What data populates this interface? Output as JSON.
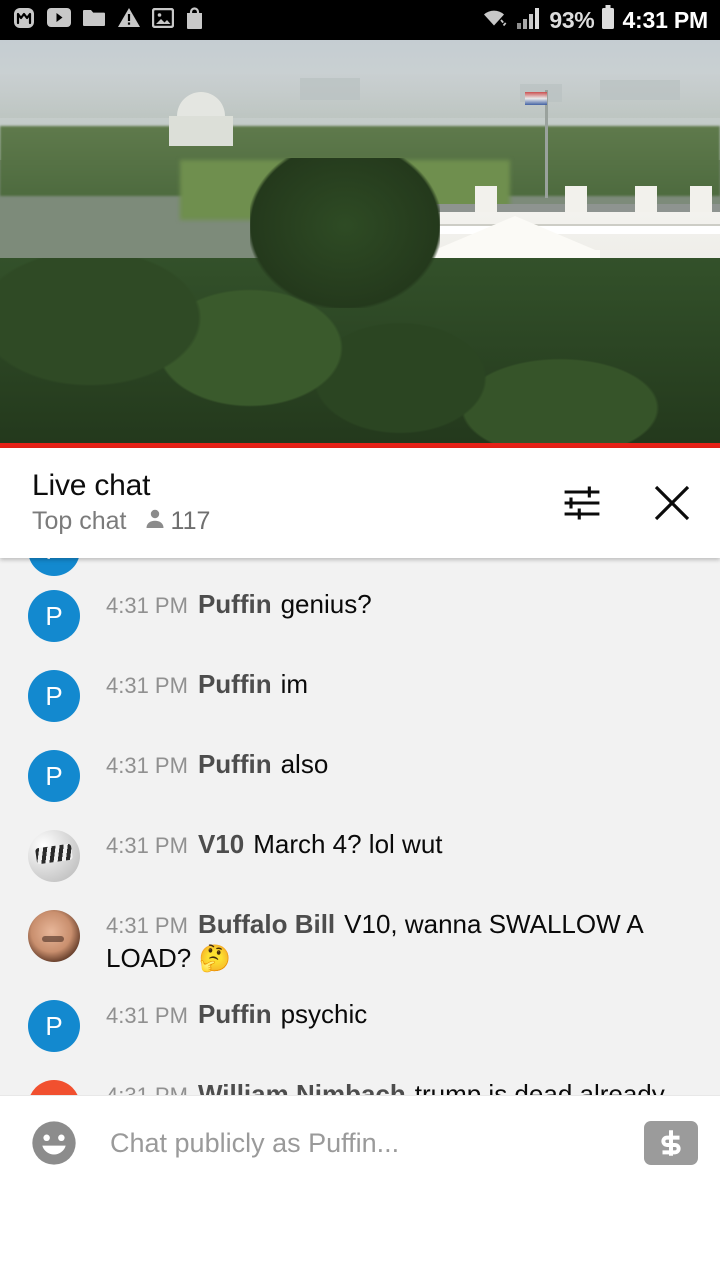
{
  "status_bar": {
    "left_icons": [
      "monzo-m-icon",
      "youtube-play-icon",
      "folder-icon",
      "warning-triangle-icon",
      "image-icon",
      "shopping-bag-icon"
    ],
    "right_icons": [
      "wifi-icon",
      "cellular-signal-icon",
      "battery-icon"
    ],
    "battery_percent": "93%",
    "time": "4:31 PM"
  },
  "video": {
    "description": "White House live stream",
    "progress_color": "#e62117"
  },
  "chat_header": {
    "title": "Live chat",
    "mode": "Top chat",
    "viewer_count": "117",
    "viewer_icon": "person-icon",
    "settings_icon": "tune-sliders-icon",
    "close_icon": "close-x-icon"
  },
  "messages": [
    {
      "avatar_type": "initial",
      "avatar_letter": "P",
      "avatar_color": "#1389cf",
      "timestamp": "",
      "author": "",
      "text": "",
      "partial": true
    },
    {
      "avatar_type": "initial",
      "avatar_letter": "P",
      "avatar_color": "#1389cf",
      "timestamp": "4:31 PM",
      "author": "Puffin",
      "text": "genius?"
    },
    {
      "avatar_type": "initial",
      "avatar_letter": "P",
      "avatar_color": "#1389cf",
      "timestamp": "4:31 PM",
      "author": "Puffin",
      "text": "im"
    },
    {
      "avatar_type": "initial",
      "avatar_letter": "P",
      "avatar_color": "#1389cf",
      "timestamp": "4:31 PM",
      "author": "Puffin",
      "text": "also"
    },
    {
      "avatar_type": "photo-gray",
      "avatar_letter": "",
      "avatar_color": "#cfcfcf",
      "timestamp": "4:31 PM",
      "author": "V10",
      "text": "March 4? lol wut"
    },
    {
      "avatar_type": "photo-face",
      "avatar_letter": "",
      "avatar_color": "#8a5a41",
      "timestamp": "4:31 PM",
      "author": "Buffalo Bill",
      "text": "V10, wanna SWALLOW A LOAD? 🤔"
    },
    {
      "avatar_type": "initial",
      "avatar_letter": "P",
      "avatar_color": "#1389cf",
      "timestamp": "4:31 PM",
      "author": "Puffin",
      "text": "psychic"
    },
    {
      "avatar_type": "initial",
      "avatar_letter": "W",
      "avatar_color": "#f1502f",
      "timestamp": "4:31 PM",
      "author": "William Nimbach",
      "text": "trump is dead already trust the plan LGBTQANON"
    }
  ],
  "input_bar": {
    "emoji_icon": "emoji-smiley-icon",
    "placeholder": "Chat publicly as Puffin...",
    "value": "",
    "superchat_icon": "dollar-sign-icon"
  }
}
